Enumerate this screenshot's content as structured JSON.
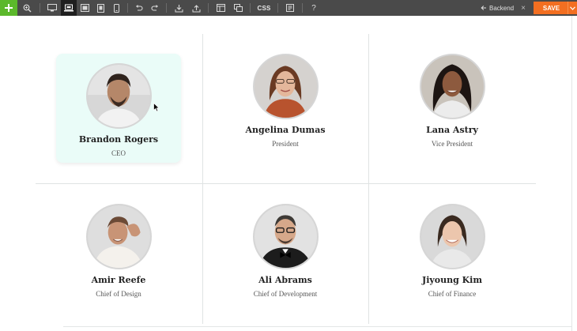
{
  "toolbar": {
    "tools": [
      {
        "name": "zoom-icon"
      },
      {
        "name": "desktop-view-icon"
      },
      {
        "name": "laptop-view-icon",
        "active": true
      },
      {
        "name": "tablet-landscape-icon"
      },
      {
        "name": "tablet-portrait-icon"
      },
      {
        "name": "mobile-view-icon"
      },
      {
        "name": "undo-icon"
      },
      {
        "name": "redo-icon"
      },
      {
        "name": "download-icon"
      },
      {
        "name": "upload-icon"
      },
      {
        "name": "layout-icon"
      },
      {
        "name": "duplicate-icon"
      },
      {
        "name": "page-settings-icon"
      }
    ],
    "css_label": "CSS",
    "help_label": "?",
    "backend_label": "Backend",
    "close_label": "×",
    "save_label": "SAVE",
    "accent_add": "#5bb82b",
    "accent_save": "#f36f21"
  },
  "team": [
    {
      "name": "Brandon Rogers",
      "role": "CEO",
      "highlighted": true
    },
    {
      "name": "Angelina Dumas",
      "role": "President"
    },
    {
      "name": "Lana Astry",
      "role": "Vice President"
    },
    {
      "name": "Amir Reefe",
      "role": "Chief of Design"
    },
    {
      "name": "Ali Abrams",
      "role": "Chief of Development"
    },
    {
      "name": "Jiyoung Kim",
      "role": "Chief of Finance"
    }
  ],
  "colors": {
    "highlight_bg": "#eafcf8",
    "divider": "#dfe3e3"
  }
}
